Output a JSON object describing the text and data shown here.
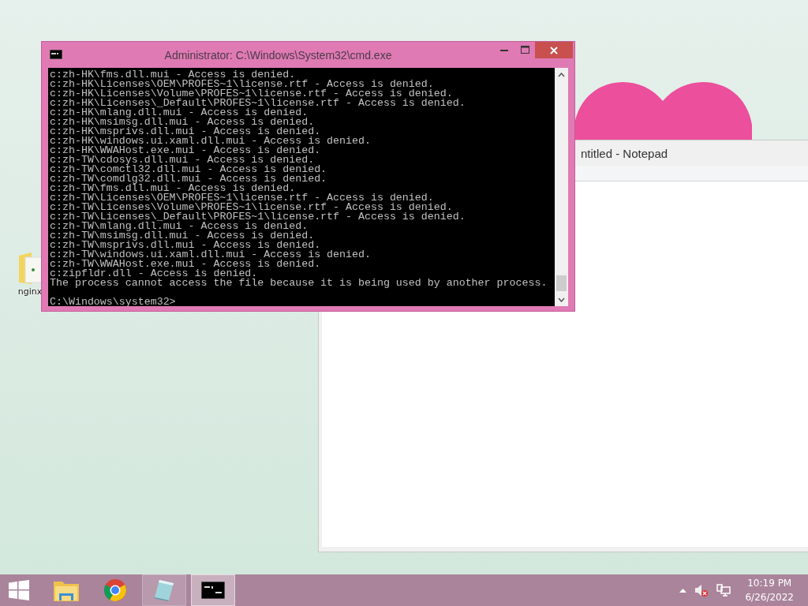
{
  "desktop_icons": [
    {
      "label": "nginx"
    }
  ],
  "notepad_window": {
    "title": "ntitled - Notepad"
  },
  "cmd_window": {
    "title": "Administrator: C:\\Windows\\System32\\cmd.exe",
    "lines": [
      "c:zh-HK\\fms.dll.mui - Access is denied.",
      "c:zh-HK\\Licenses\\OEM\\PROFES~1\\license.rtf - Access is denied.",
      "c:zh-HK\\Licenses\\Volume\\PROFES~1\\license.rtf - Access is denied.",
      "c:zh-HK\\Licenses\\_Default\\PROFES~1\\license.rtf - Access is denied.",
      "c:zh-HK\\mlang.dll.mui - Access is denied.",
      "c:zh-HK\\msimsg.dll.mui - Access is denied.",
      "c:zh-HK\\msprivs.dll.mui - Access is denied.",
      "c:zh-HK\\windows.ui.xaml.dll.mui - Access is denied.",
      "c:zh-HK\\WWAHost.exe.mui - Access is denied.",
      "c:zh-TW\\cdosys.dll.mui - Access is denied.",
      "c:zh-TW\\comctl32.dll.mui - Access is denied.",
      "c:zh-TW\\comdlg32.dll.mui - Access is denied.",
      "c:zh-TW\\fms.dll.mui - Access is denied.",
      "c:zh-TW\\Licenses\\OEM\\PROFES~1\\license.rtf - Access is denied.",
      "c:zh-TW\\Licenses\\Volume\\PROFES~1\\license.rtf - Access is denied.",
      "c:zh-TW\\Licenses\\_Default\\PROFES~1\\license.rtf - Access is denied.",
      "c:zh-TW\\mlang.dll.mui - Access is denied.",
      "c:zh-TW\\msimsg.dll.mui - Access is denied.",
      "c:zh-TW\\msprivs.dll.mui - Access is denied.",
      "c:zh-TW\\windows.ui.xaml.dll.mui - Access is denied.",
      "c:zh-TW\\WWAHost.exe.mui - Access is denied.",
      "c:zipfldr.dll - Access is denied.",
      "The process cannot access the file because it is being used by another process."
    ],
    "prompt": "C:\\Windows\\system32>"
  },
  "taskbar": {
    "apps": [
      {
        "kind": "explorer",
        "running": false,
        "selected": false
      },
      {
        "kind": "chrome",
        "running": false,
        "selected": false
      },
      {
        "kind": "notepad",
        "running": true,
        "selected": false
      },
      {
        "kind": "cmd",
        "running": true,
        "selected": true
      }
    ],
    "time": "10:19 PM",
    "date": "6/26/2022"
  }
}
